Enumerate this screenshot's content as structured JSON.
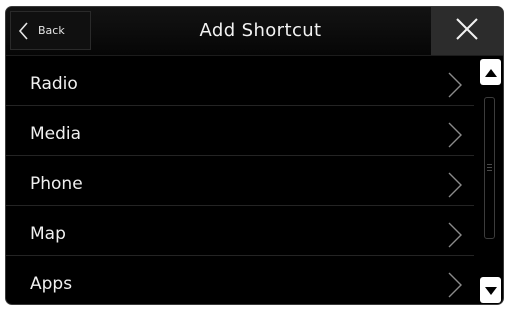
{
  "header": {
    "back_label": "Back",
    "title": "Add Shortcut"
  },
  "icons": {
    "back": "chevron-left-icon",
    "close": "close-icon",
    "item": "chevron-right-icon",
    "scroll_up": "triangle-up-icon",
    "scroll_down": "triangle-down-icon"
  },
  "list": {
    "items": [
      {
        "label": "Radio"
      },
      {
        "label": "Media"
      },
      {
        "label": "Phone"
      },
      {
        "label": "Map"
      },
      {
        "label": "Apps"
      }
    ]
  },
  "colors": {
    "background": "#000000",
    "text": "#f0f0f0",
    "close_bg": "#2c2c2c",
    "scroll_button": "#ffffff"
  }
}
